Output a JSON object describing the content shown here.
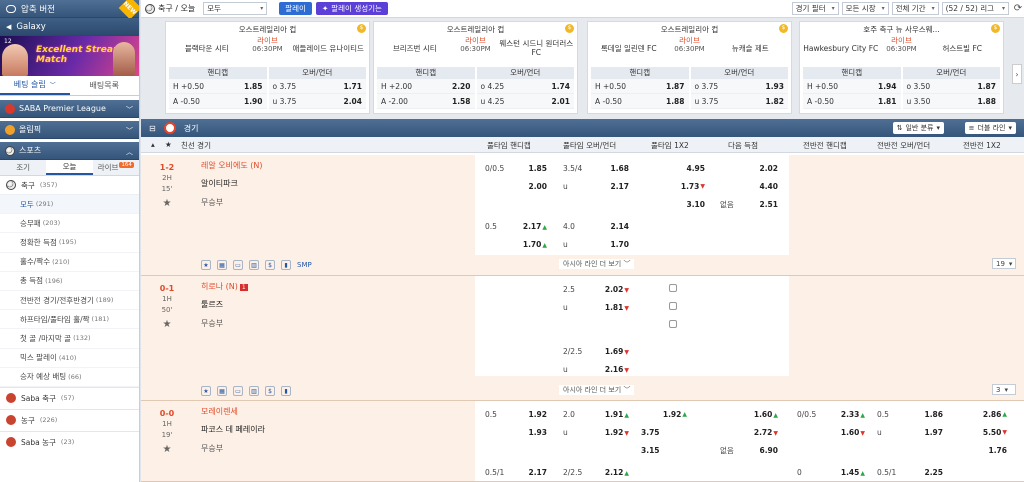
{
  "sidebar": {
    "quick_bet": "압축 버전",
    "galaxy": "Galaxy",
    "banner_text": "Excellent Streamer Match",
    "banner_num": "12",
    "new_badge": "NEW",
    "tabs": [
      "베팅 슬립",
      "배팅목록"
    ],
    "sections": [
      "SABA Premier League",
      "올림픽",
      "스포츠"
    ],
    "sub_tabs": [
      "조기",
      "오늘",
      "라이브"
    ],
    "live_count": "164",
    "soccer": {
      "label": "축구",
      "count": "(357)"
    },
    "bet_types": [
      {
        "label": "모두",
        "count": "(291)"
      },
      {
        "label": "승무패",
        "count": "(203)"
      },
      {
        "label": "정확한 득점",
        "count": "(195)"
      },
      {
        "label": "홀수/짝수",
        "count": "(210)"
      },
      {
        "label": "총 득점",
        "count": "(196)"
      },
      {
        "label": "전반전 경기/전후반경기",
        "count": "(189)"
      },
      {
        "label": "하프타임/풀타임 홀/짝",
        "count": "(181)"
      },
      {
        "label": "첫 골 /마지막 골",
        "count": "(132)"
      },
      {
        "label": "믹스 팔레이",
        "count": "(410)"
      },
      {
        "label": "승자 예상 배팅",
        "count": "(66)"
      }
    ],
    "other_sports": [
      {
        "label": "Saba 축구",
        "count": "(57)"
      },
      {
        "label": "농구",
        "count": "(226)"
      },
      {
        "label": "Saba 농구",
        "count": "(23)"
      }
    ]
  },
  "topbar": {
    "title": "축구 / 오늘",
    "select": "모두",
    "parlay": "팔레이",
    "parlay_gen": "팔레이 생성기는",
    "filter": "경기 필터",
    "market": "모든 시장",
    "period": "전체 기간",
    "league": "(52 / 52) 리그"
  },
  "cards": [
    {
      "league": "오스트레일리아 컵",
      "home": "블랙타운 시티",
      "away": "애들레이드 유나이티드",
      "live": "라이브",
      "time": "06:30PM",
      "hdp_label": "핸디캡",
      "ou_label": "오버/언더",
      "hdp": [
        [
          "H +0.50",
          "1.85"
        ],
        [
          "A -0.50",
          "1.90"
        ]
      ],
      "ou": [
        [
          "o 3.75",
          "1.71"
        ],
        [
          "u 3.75",
          "2.04"
        ]
      ]
    },
    {
      "league": "오스트레일리아 컵",
      "home": "브리즈번 시티",
      "away": "웨스턴 시드니 원더러스 FC",
      "live": "라이브",
      "time": "06:30PM",
      "hdp_label": "핸디캡",
      "ou_label": "오버/언더",
      "hdp": [
        [
          "H +2.00",
          "2.20"
        ],
        [
          "A -2.00",
          "1.58"
        ]
      ],
      "ou": [
        [
          "o 4.25",
          "1.74"
        ],
        [
          "u 4.25",
          "2.01"
        ]
      ]
    },
    {
      "league": "오스트레일리아 컵",
      "home": "록데일 일린덴 FC",
      "away": "뉴캐슬 제트",
      "live": "라이브",
      "time": "06:30PM",
      "hdp_label": "핸디캡",
      "ou_label": "오버/언더",
      "hdp": [
        [
          "H +0.50",
          "1.87"
        ],
        [
          "A -0.50",
          "1.88"
        ]
      ],
      "ou": [
        [
          "o 3.75",
          "1.93"
        ],
        [
          "u 3.75",
          "1.82"
        ]
      ]
    },
    {
      "league": "호주 축구 뉴 사우스웨...",
      "home": "Hawkesbury City FC",
      "away": "허스트빌 FC",
      "live": "라이브",
      "time": "06:30PM",
      "hdp_label": "핸디캡",
      "ou_label": "오버/언더",
      "hdp": [
        [
          "H +0.50",
          "1.94"
        ],
        [
          "A -0.50",
          "1.81"
        ]
      ],
      "ou": [
        [
          "o 3.50",
          "1.87"
        ],
        [
          "u 3.50",
          "1.88"
        ]
      ]
    }
  ],
  "grid": {
    "section": "경기",
    "sort": "일반 분류",
    "lines": "더블 라인",
    "headers": [
      "친선 경기",
      "풀타임 핸디캡",
      "풀타임 오버/언더",
      "풀타임 1X2",
      "다음 득점",
      "전반전 핸디캡",
      "전반전 오버/언더",
      "전반전 1X2"
    ],
    "more_asia": "아시아 라인 더 보기",
    "smp": "SMP",
    "matches": [
      {
        "score": "1-2",
        "half": "2H",
        "min": "15'",
        "home": "레알 오비에도 (N)",
        "away": "알이티파크",
        "draw": "무승부",
        "dd": "19",
        "hdp": [
          [
            "0/0.5",
            "1.85"
          ],
          [
            "",
            "2.00"
          ],
          [
            "0.5",
            "2.17"
          ],
          [
            "",
            "1.70"
          ]
        ],
        "ou": [
          [
            "3.5/4",
            "1.68"
          ],
          [
            "u",
            "2.17"
          ],
          [
            "4.0",
            "2.14"
          ],
          [
            "u",
            "1.70"
          ]
        ],
        "x12": [
          "4.95",
          "1.73",
          "3.10"
        ],
        "next": [
          [
            "",
            "2.02"
          ],
          [
            "",
            "4.40"
          ],
          [
            "없음",
            "2.51"
          ]
        ]
      },
      {
        "score": "0-1",
        "half": "1H",
        "min": "50'",
        "home": "히로나 (N)",
        "red": "1",
        "away": "툴르즈",
        "draw": "무승부",
        "dd": "3",
        "ou": [
          [
            "2.5",
            "2.02"
          ],
          [
            "u",
            "1.81"
          ],
          [
            "2/2.5",
            "1.69"
          ],
          [
            "u",
            "2.16"
          ]
        ]
      },
      {
        "score": "0-0",
        "half": "1H",
        "min": "19'",
        "home": "모레이렌세",
        "away": "파코스 데 페레이라",
        "draw": "무승부",
        "hdp": [
          [
            "0.5",
            "1.92"
          ],
          [
            "",
            "1.93"
          ],
          [
            "0.5/1",
            "2.17"
          ]
        ],
        "ou": [
          [
            "2.0",
            "1.91"
          ],
          [
            "u",
            "1.92"
          ],
          [
            "2/2.5",
            "2.12"
          ]
        ],
        "x12": [
          "1.92",
          "3.75",
          "3.15"
        ],
        "next": [
          [
            "",
            "1.60"
          ],
          [
            "",
            "2.72"
          ],
          [
            "없음",
            "6.90"
          ]
        ],
        "fh_hdp": [
          [
            "0/0.5",
            "2.33"
          ],
          [
            "",
            "1.60"
          ],
          [
            "0",
            "1.45"
          ]
        ],
        "fh_ou": [
          [
            "0.5",
            "1.86"
          ],
          [
            "u",
            "1.97"
          ],
          [
            "0.5/1",
            "2.25"
          ]
        ],
        "fh_x12": [
          "2.86",
          "5.50",
          "1.76"
        ]
      }
    ]
  }
}
